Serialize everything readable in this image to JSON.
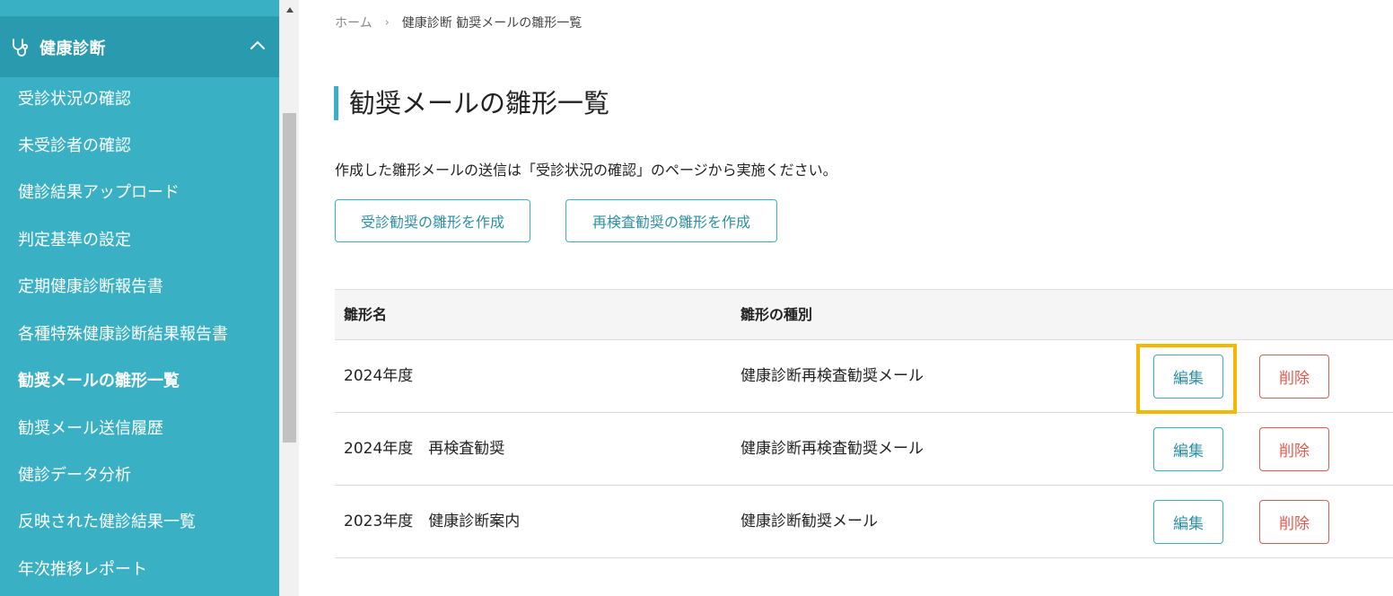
{
  "sidebar": {
    "section_title": "健康診断",
    "section_icon": "stethoscope-icon",
    "items": [
      {
        "label": "受診状況の確認",
        "active": false
      },
      {
        "label": "未受診者の確認",
        "active": false
      },
      {
        "label": "健診結果アップロード",
        "active": false
      },
      {
        "label": "判定基準の設定",
        "active": false
      },
      {
        "label": "定期健康診断報告書",
        "active": false
      },
      {
        "label": "各種特殊健康診断結果報告書",
        "active": false
      },
      {
        "label": "勧奨メールの雛形一覧",
        "active": true
      },
      {
        "label": "勧奨メール送信履歴",
        "active": false
      },
      {
        "label": "健診データ分析",
        "active": false
      },
      {
        "label": "反映された健診結果一覧",
        "active": false
      },
      {
        "label": "年次推移レポート",
        "active": false
      }
    ]
  },
  "breadcrumb": {
    "home": "ホーム",
    "separator": "›",
    "current": "健康診断 勧奨メールの雛形一覧"
  },
  "page": {
    "title": "勧奨メールの雛形一覧",
    "description": "作成した雛形メールの送信は「受診状況の確認」のページから実施ください。",
    "create_consultation_button": "受診勧奨の雛形を作成",
    "create_reexam_button": "再検査勧奨の雛形を作成"
  },
  "table": {
    "headers": {
      "name": "雛形名",
      "type": "雛形の種別"
    },
    "edit_label": "編集",
    "delete_label": "削除",
    "rows": [
      {
        "name": "2024年度",
        "type": "健康診断再検査勧奨メール"
      },
      {
        "name": "2024年度　再検査勧奨",
        "type": "健康診断再検査勧奨メール"
      },
      {
        "name": "2023年度　健康診断案内",
        "type": "健康診断勧奨メール"
      }
    ]
  },
  "colors": {
    "sidebar_bg": "#3ab0c4",
    "section_bg": "#2a9aaf",
    "accent": "#3ab0c4",
    "delete": "#e05a4e",
    "highlight": "#f5b800"
  }
}
